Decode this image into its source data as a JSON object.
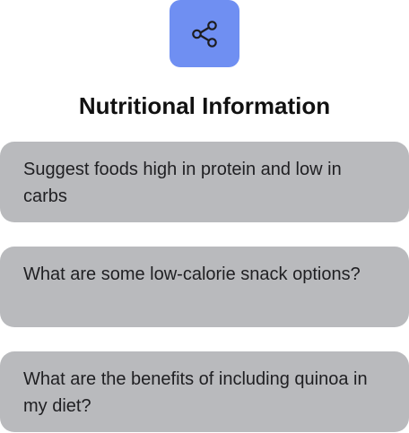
{
  "header": {
    "share_icon": "share-icon",
    "accent_color": "#6f8ff2",
    "title": "Nutritional Information"
  },
  "prompts": [
    {
      "text": "Suggest foods high in protein and low in carbs"
    },
    {
      "text": "What are some low-calorie snack options?"
    },
    {
      "text": "What are the benefits of including quinoa in my diet?"
    }
  ]
}
